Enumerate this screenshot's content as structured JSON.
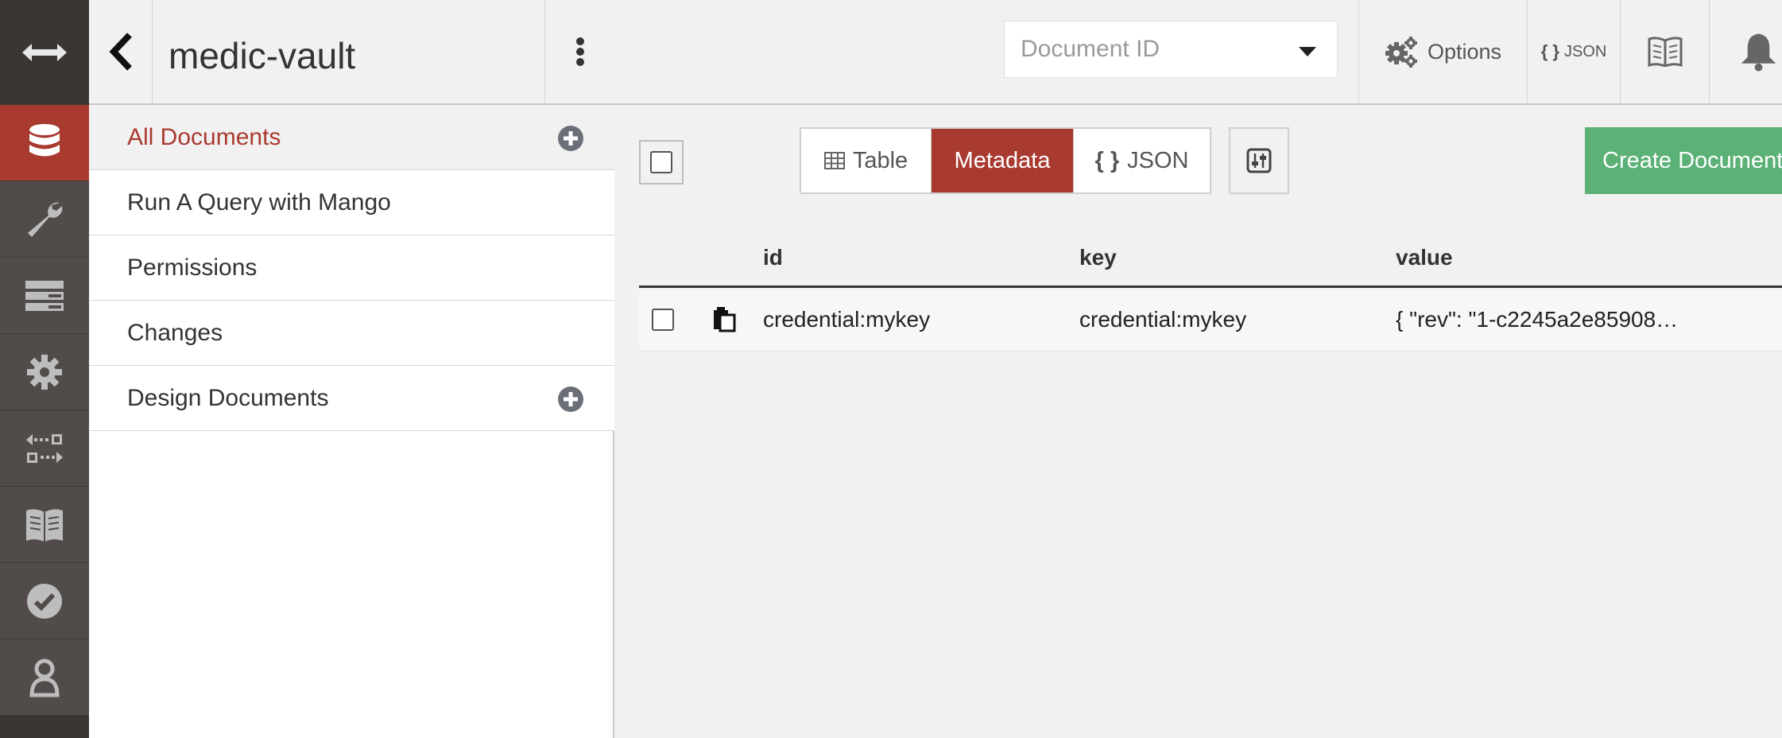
{
  "sidebar": {
    "db_name": "medic-vault",
    "items": [
      {
        "label": "All Documents"
      },
      {
        "label": "Run A Query with Mango"
      },
      {
        "label": "Permissions"
      },
      {
        "label": "Changes"
      },
      {
        "label": "Design Documents"
      }
    ]
  },
  "header": {
    "doc_id_placeholder": "Document ID",
    "options_label": "Options",
    "json_label": "JSON",
    "json_braces": "{ }"
  },
  "toolbar": {
    "view_table": "Table",
    "view_metadata": "Metadata",
    "view_json": "JSON",
    "json_braces": "{ }",
    "create_document": "Create Document"
  },
  "table": {
    "columns": [
      "id",
      "key",
      "value"
    ],
    "rows": [
      {
        "id": "credential:mykey",
        "key": "credential:mykey",
        "value": "{ \"rev\": \"1-c2245a2e85908…"
      }
    ]
  },
  "colors": {
    "accent": "#a93a2f",
    "create_button": "#5cb176",
    "nav_background": "#514c4a"
  },
  "icons": {
    "nav": [
      "collapse-arrows-icon",
      "database-icon",
      "wrench-icon",
      "server-icon",
      "gear-icon",
      "replication-icon",
      "book-icon",
      "check-circle-icon",
      "user-icon"
    ]
  }
}
